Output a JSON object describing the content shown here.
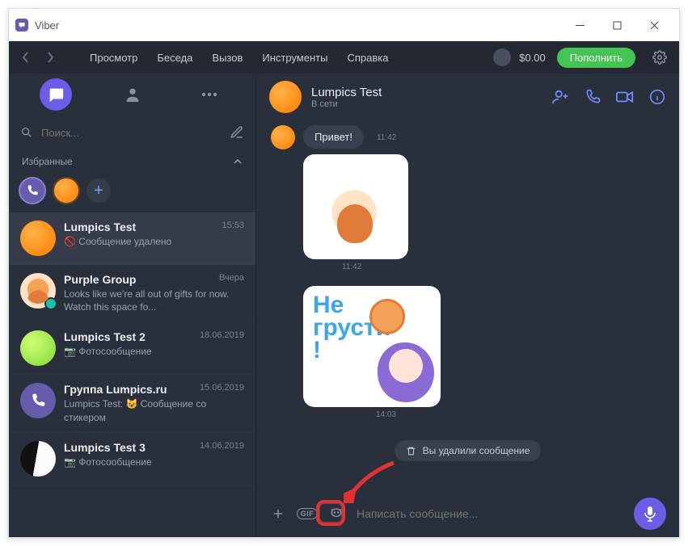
{
  "window": {
    "title": "Viber"
  },
  "menubar": {
    "items": [
      "Просмотр",
      "Беседа",
      "Вызов",
      "Инструменты",
      "Справка"
    ],
    "balance": "$0.00",
    "topup": "Пополнить"
  },
  "sidebar": {
    "search_placeholder": "Поиск...",
    "favorites_label": "Избранные",
    "chats": [
      {
        "name": "Lumpics Test",
        "time": "15:53",
        "preview": "🚫 Сообщение удалено",
        "avatar": "orange",
        "selected": true
      },
      {
        "name": "Purple Group",
        "time": "Вчера",
        "preview": "Looks like we're all out of gifts for now. Watch this space fo...",
        "avatar": "cat",
        "badge": true
      },
      {
        "name": "Lumpics Test 2",
        "time": "18.06.2019",
        "preview": "📷 Фотосообщение",
        "avatar": "lime"
      },
      {
        "name": "Группа Lumpics.ru",
        "time": "15.06.2019",
        "preview": "Lumpics Test: 😺 Сообщение со стикером",
        "avatar": "viberg"
      },
      {
        "name": "Lumpics Test 3",
        "time": "14.06.2019",
        "preview": "📷 Фотосообщение",
        "avatar": "half"
      }
    ]
  },
  "chat": {
    "title": "Lumpics Test",
    "status": "В сети",
    "messages": {
      "m1_text": "Привет!",
      "m1_time": "11:42",
      "s1_time": "11:42",
      "s2_text_line1": "Не",
      "s2_text_line2": "грусти",
      "s2_text_line3": "!",
      "s2_time": "14:03",
      "deleted": "Вы удалили сообщение"
    },
    "composer_placeholder": "Написать сообщение..."
  }
}
